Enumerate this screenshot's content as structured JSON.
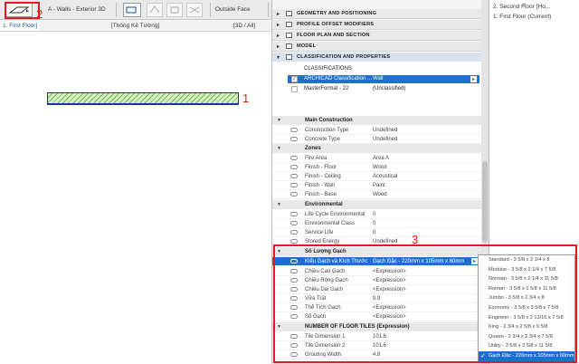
{
  "toolbar": {
    "layer_label": "A - Walls - Exterior 3D",
    "plane_label": "Outside Face"
  },
  "tabs": [
    {
      "label": "1. First Floor]"
    },
    {
      "label": "[Thông Kê Tường]"
    },
    {
      "label": "[3D / All]"
    }
  ],
  "annotations": [
    "1",
    "2",
    "3"
  ],
  "right_panel": {
    "items": [
      "2. Second Floor [Ho...",
      "1. First Floor (Current)"
    ]
  },
  "sections": [
    {
      "label": "GEOMETRY AND POSITIONING"
    },
    {
      "label": "PROFILE OFFSET MODIFIERS"
    },
    {
      "label": "FLOOR PLAN AND SECTION"
    },
    {
      "label": "MODEL"
    },
    {
      "label": "CLASSIFICATION AND PROPERTIES"
    }
  ],
  "classifications": {
    "header": "CLASSIFICATIONS",
    "rows": [
      {
        "name": "ARCHICAD Classification ...",
        "value": "Wall"
      },
      {
        "name": "MasterFormat - 22",
        "value": "(Unclassified)"
      }
    ]
  },
  "groups": [
    {
      "label": "Main Construction"
    },
    {
      "label": "Zones"
    },
    {
      "label": "Environmental"
    },
    {
      "label": "Số Lượng Gạch"
    },
    {
      "label": "NUMBER OF FLOOR TILES (Expression)"
    }
  ],
  "properties": [
    {
      "name": "Construction Type",
      "value": "Undefined"
    },
    {
      "name": "Concrete Type",
      "value": "Undefined"
    },
    {
      "name": "Fire Area",
      "value": "Area A"
    },
    {
      "name": "Finish - Floor",
      "value": "Wood"
    },
    {
      "name": "Finish - Ceiling",
      "value": "Acoustical"
    },
    {
      "name": "Finish - Wall",
      "value": "Paint"
    },
    {
      "name": "Finish - Base",
      "value": "Wood"
    },
    {
      "name": "Life Cycle Environmental",
      "value": "0"
    },
    {
      "name": "Environmental Class",
      "value": "0"
    },
    {
      "name": "Service Life",
      "value": "0"
    },
    {
      "name": "Stored Energy",
      "value": "Undefined"
    },
    {
      "name": "Kiểu Gạch và Kích Thước",
      "value": "Gạch Đặc - 220mm x 105mm x 60mm"
    },
    {
      "name": "Chiều Cao Gạch",
      "value": "<Expression>"
    },
    {
      "name": "Chiều Rộng Gạch",
      "value": "<Expression>"
    },
    {
      "name": "Chiều Dài Gạch",
      "value": "<Expression>"
    },
    {
      "name": "Vữa Trát",
      "value": "9.9"
    },
    {
      "name": "Thể Tích Gạch",
      "value": "<Expression>"
    },
    {
      "name": "Số Gạch",
      "value": "<Expression>"
    },
    {
      "name": "Tile Dimension 1",
      "value": "101.6"
    },
    {
      "name": "Tile Dimension 2",
      "value": "101.6"
    },
    {
      "name": "Grouting Width",
      "value": "4.8"
    }
  ],
  "dropdown": {
    "options": [
      "Standard - 3 5/8 x 2 1/4 x 8",
      "Modular - 3 5/8 x 2 1/4 x 7 5/8",
      "Norman - 3 5/8 x 2 1/4 x 11 5/8",
      "Roman - 3 5/8 x 1 5/8 x 11 5/8",
      "Jumbo - 3 5/8 x 2 3/4 x 8",
      "Economy - 3 5/8 x 3 5/8 x 7 5/8",
      "Engineer - 3 5/8 x 2 13/16 x 7 5/8",
      "King - 2 3/4 x 2 5/8 x 9 5/8",
      "Queen - 2 3/4 x 2 3/4 x 7 5/8",
      "Utility - 3 5/8 x 3 5/8 x 11 5/8",
      "Gạch Đặc - 220mm x 105mm x 60mm"
    ],
    "selected_index": 10
  },
  "colors": {
    "accent": "#1f6fd0",
    "annotation_red": "#e11b1b",
    "wall_fill": "#6bbd4f"
  }
}
